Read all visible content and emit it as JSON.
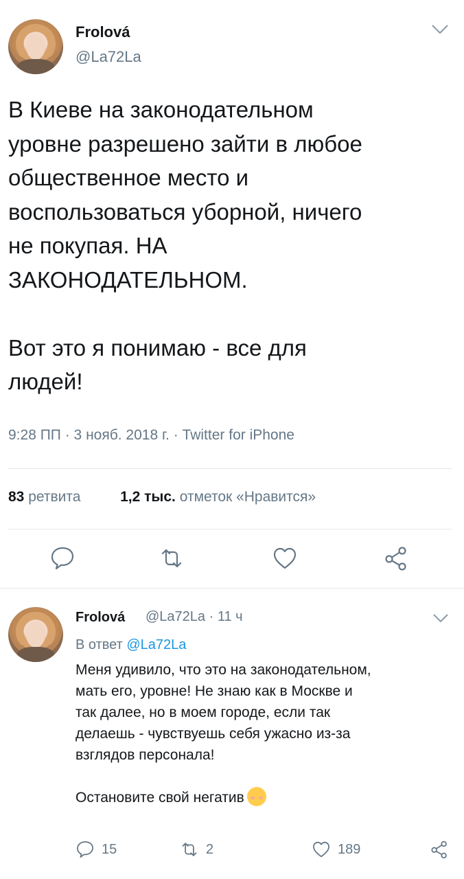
{
  "tweet": {
    "name": "Frolová",
    "handle": "@La72La",
    "text": "В Киеве на законодательном\nуровне разрешено зайти в любое\nобщественное место и\nвоспользоваться уборной, ничего\nне покупая. НА\nЗАКОНОДАТЕЛЬНОМ.\n\nВот это я понимаю - все для\nлюдей!",
    "meta": "9:28 ПП · 3 нояб. 2018 г. · Twitter for iPhone",
    "retweets_count": "83",
    "retweets_label": "ретвита",
    "likes_count": "1,2 тыс.",
    "likes_label": "отметок «Нравится»"
  },
  "reply": {
    "name": "Frolová",
    "handle_time": "@La72La · 11 ч",
    "replying_prefix": "В ответ ",
    "replying_to": "@La72La",
    "text": "Меня удивило, что это на законодательном,\nмать его, уровне! Не знаю как в Москве и\nтак далее, но в моем городе, если так\nделаешь - чувствуешь себя ужасно из-за\nвзглядов персонала!\n\nОстановите свой негатив",
    "reply_count": "15",
    "retweet_count": "2",
    "like_count": "189"
  },
  "icons": {
    "caret": "chevron-down-icon",
    "reply": "reply-icon",
    "retweet": "retweet-icon",
    "like": "heart-icon",
    "share": "share-icon",
    "emoji": "blush-emoji"
  },
  "colors": {
    "text": "#14171a",
    "secondary": "#657786",
    "link": "#1b95e0",
    "divider": "#e1e8ed"
  }
}
